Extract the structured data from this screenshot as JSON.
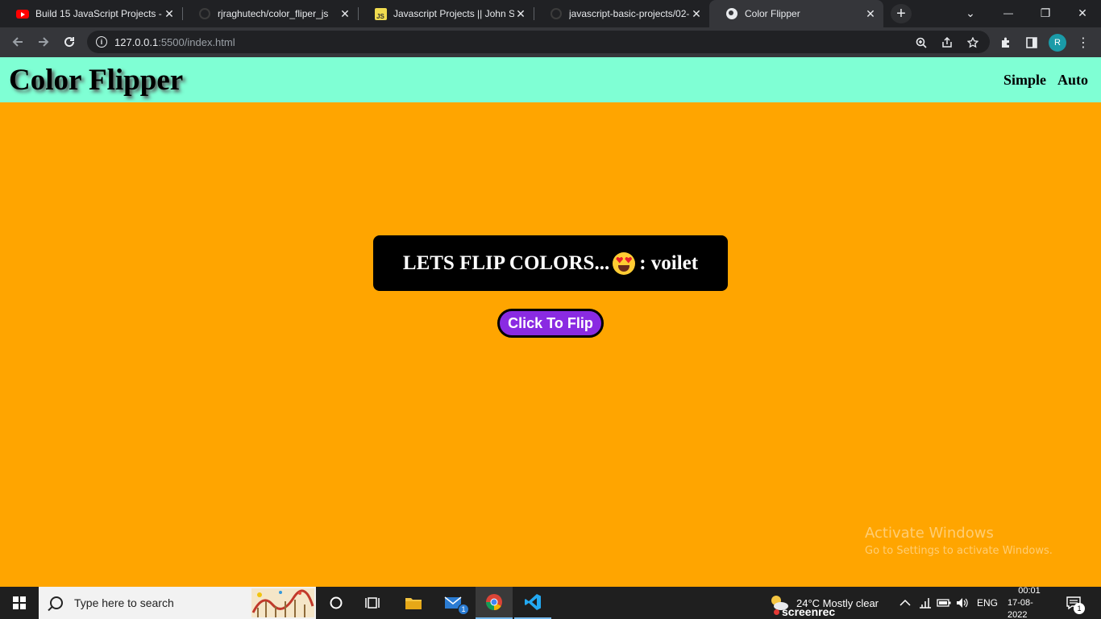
{
  "browser": {
    "tabs": [
      {
        "title": "Build 15 JavaScript Projects -",
        "favicon": "youtube-icon",
        "active": false
      },
      {
        "title": "rjraghutech/color_fliper_js",
        "favicon": "github-icon",
        "active": false
      },
      {
        "title": "Javascript Projects || John Sm",
        "favicon": "js-icon",
        "active": false
      },
      {
        "title": "javascript-basic-projects/02-",
        "favicon": "github-icon",
        "active": false
      },
      {
        "title": "Color Flipper",
        "favicon": "globe-icon",
        "active": true
      }
    ],
    "tab_close_glyph": "✕",
    "js_favicon_text": "JS",
    "new_tab_glyph": "+",
    "window_controls": {
      "tab_search": "⌄",
      "minimize": "—",
      "restore": "❐",
      "close": "✕"
    },
    "url_host": "127.0.0.1",
    "url_rest": ":5500/index.html",
    "profile_initial": "R"
  },
  "page": {
    "brand": "Color Flipper",
    "nav_links": [
      "Simple",
      "Auto"
    ],
    "message_prefix": "LETS FLIP COLORS...",
    "message_suffix": ": voilet",
    "button_label": "Click To Flip",
    "background_color": "#ffa500",
    "navbar_color": "#7fffd4",
    "button_color": "#8a2be2"
  },
  "watermark": {
    "line1": "Activate Windows",
    "line2": "Go to Settings to activate Windows."
  },
  "taskbar": {
    "search_placeholder": "Type here to search",
    "mail_badge": "1",
    "weather": "24°C  Mostly clear",
    "screenrec_label": "screenrec",
    "language": "ENG",
    "time": "00:01",
    "date": "17-08-2022",
    "notification_badge": "1"
  }
}
